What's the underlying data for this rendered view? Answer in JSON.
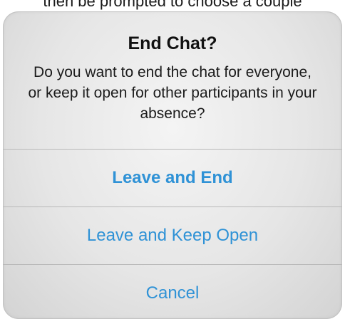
{
  "background": {
    "caption_fragment": "then be prompted to choose a couple"
  },
  "alert": {
    "title": "End Chat?",
    "message": "Do you want to end the chat for everyone, or keep it open for other participants in your absence?",
    "actions": [
      {
        "label": "Leave and End",
        "style": "bold"
      },
      {
        "label": "Leave and Keep Open",
        "style": "regular"
      },
      {
        "label": "Cancel",
        "style": "regular"
      }
    ]
  },
  "colors": {
    "action_text": "#2f92d6",
    "title_text": "#111111",
    "separator": "#b9b9b9"
  }
}
